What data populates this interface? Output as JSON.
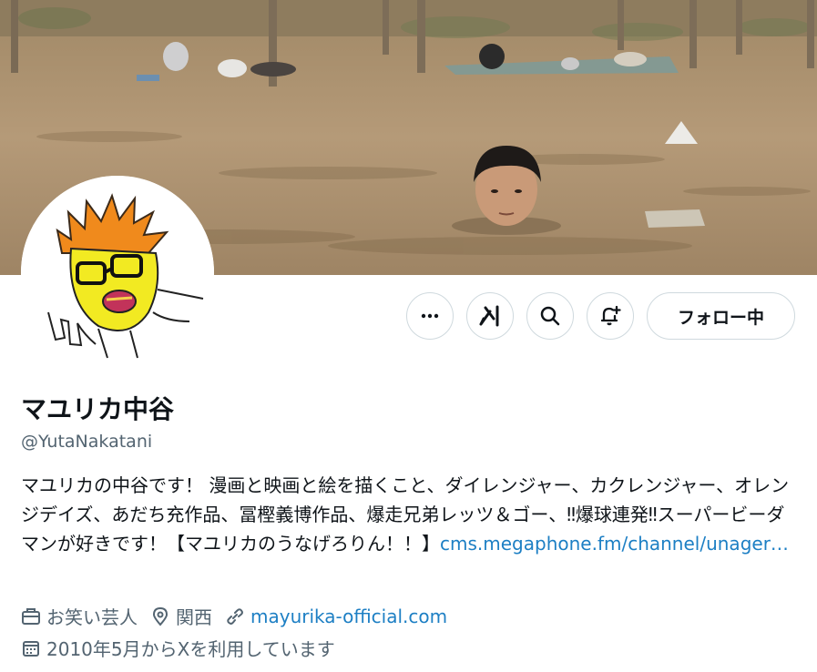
{
  "profile": {
    "display_name": "マユリカ中谷",
    "handle": "@YutaNakatani",
    "bio_text": "マユリカの中谷です！ 漫画と映画と絵を描くこと、ダイレンジャー、カクレンジャー、オレンジデイズ、あだち充作品、冨樫義博作品、爆走兄弟レッツ＆ゴー、‼爆球連発‼スーパービーダマンが好きです！【マユリカのうなげろりん！！】",
    "bio_link": "cms.megaphone.fm/channel/unager…"
  },
  "actions": {
    "more_icon": "more-icon",
    "grok_icon": "grok-icon",
    "search_icon": "search-icon",
    "notify_icon": "notification-bell-icon",
    "follow_label": "フォロー中"
  },
  "meta": {
    "category": "お笑い芸人",
    "location": "関西",
    "website": "mayurika-official.com",
    "joined": "2010年5月からXを利用しています"
  }
}
